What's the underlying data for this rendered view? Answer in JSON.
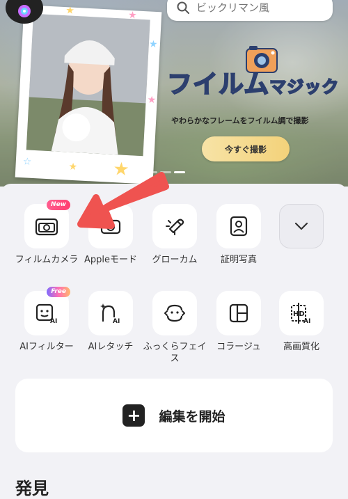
{
  "search": {
    "placeholder": "ビックリマン風"
  },
  "banner": {
    "title_main": "フイルム",
    "title_small": "マジック",
    "subtitle": "やわらかなフレームをフイルム調で撮影",
    "cta_label": "今すぐ撮影",
    "pager_count": 3,
    "pager_active": 2
  },
  "tools": [
    {
      "label": "フィルムカメラ",
      "icon": "film-camera-icon",
      "badge": "New"
    },
    {
      "label": "Appleモード",
      "icon": "apple-mode-icon"
    },
    {
      "label": "グローカム",
      "icon": "glow-cam-icon"
    },
    {
      "label": "証明写真",
      "icon": "id-photo-icon"
    },
    {
      "label": "",
      "icon": "chevron-down-icon"
    },
    {
      "label": "AIフィルター",
      "icon": "ai-filter-icon",
      "badge": "Free"
    },
    {
      "label": "AIレタッチ",
      "icon": "ai-retouch-icon"
    },
    {
      "label": "ふっくらフェイス",
      "icon": "plump-face-icon"
    },
    {
      "label": "コラージュ",
      "icon": "collage-icon"
    },
    {
      "label": "高画質化",
      "icon": "hd-ai-icon"
    }
  ],
  "edit": {
    "label": "編集を開始",
    "icon": "plus-icon"
  },
  "section": {
    "discover": "発見"
  },
  "colors": {
    "accent_arrow": "#ef5350",
    "badge_new": "#ff3d6f",
    "cta": "#f3d27a",
    "title_fill": "#f4c95d"
  }
}
